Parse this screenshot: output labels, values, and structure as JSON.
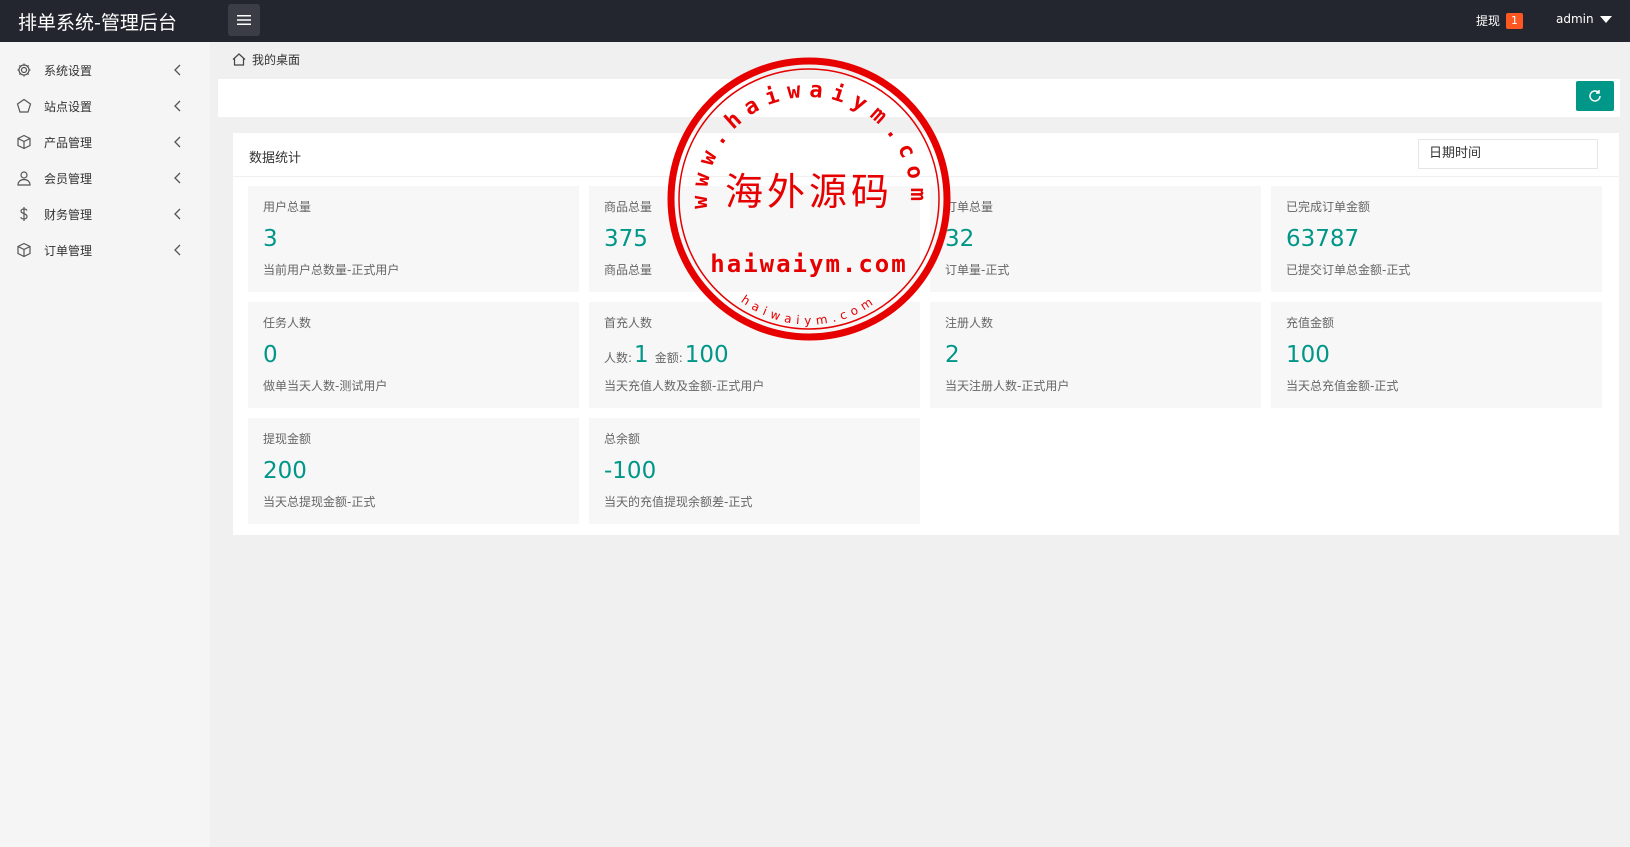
{
  "header": {
    "title": "排单系统-管理后台",
    "withdraw_label": "提现",
    "withdraw_badge": "1",
    "user": "admin"
  },
  "sidebar": {
    "items": [
      {
        "label": "系统设置",
        "icon": "gear-icon"
      },
      {
        "label": "站点设置",
        "icon": "diamond-icon"
      },
      {
        "label": "产品管理",
        "icon": "box-icon"
      },
      {
        "label": "会员管理",
        "icon": "user-icon"
      },
      {
        "label": "财务管理",
        "icon": "dollar-icon"
      },
      {
        "label": "订单管理",
        "icon": "box-icon"
      }
    ]
  },
  "breadcrumb": "我的桌面",
  "panel": {
    "title": "数据统计",
    "date_placeholder": "日期时间"
  },
  "cards": [
    {
      "title": "用户总量",
      "value": "3",
      "desc": "当前用户总数量-正式用户"
    },
    {
      "title": "商品总量",
      "value": "375",
      "desc": "商品总量"
    },
    {
      "title": "订单总量",
      "value": "32",
      "desc": "订单量-正式"
    },
    {
      "title": "已完成订单金额",
      "value": "63787",
      "desc": "已提交订单总金额-正式"
    },
    {
      "title": "任务人数",
      "value": "0",
      "desc": "做单当天人数-测试用户"
    },
    {
      "title": "首充人数",
      "count_label": "人数:",
      "count": "1",
      "amount_label": "金额:",
      "amount": "100",
      "desc": "当天充值人数及金额-正式用户"
    },
    {
      "title": "注册人数",
      "value": "2",
      "desc": "当天注册人数-正式用户"
    },
    {
      "title": "充值金额",
      "value": "100",
      "desc": "当天总充值金额-正式"
    },
    {
      "title": "提现金额",
      "value": "200",
      "desc": "当天总提现金额-正式"
    },
    {
      "title": "总余额",
      "value": "-100",
      "desc": "当天的充值提现余额差-正式"
    }
  ],
  "watermark": {
    "center_text": "海外源码",
    "domain_text": "haiwaiym.com",
    "ring_text": "www.haiwaiym.com",
    "small_text": "haiwaiym.com",
    "color": "#e60000"
  },
  "colors": {
    "accent": "#009688",
    "topbar": "#23262e",
    "badge": "#ff5722"
  }
}
